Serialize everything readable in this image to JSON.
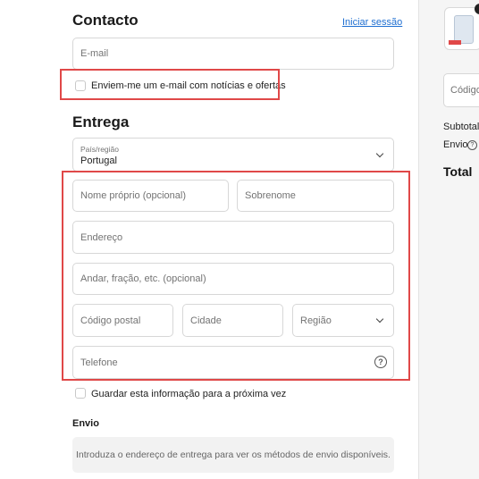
{
  "contact": {
    "title": "Contacto",
    "login_link": "Iniciar sessão",
    "email_placeholder": "E-mail",
    "newsletter_label": "Enviem-me um e-mail com notícias e ofertas"
  },
  "delivery": {
    "title": "Entrega",
    "country_label": "País/região",
    "country_value": "Portugal",
    "first_name_placeholder": "Nome próprio (opcional)",
    "last_name_placeholder": "Sobrenome",
    "address_placeholder": "Endereço",
    "apartment_placeholder": "Andar, fração, etc. (opcional)",
    "postal_code_placeholder": "Código postal",
    "city_placeholder": "Cidade",
    "region_placeholder": "Região",
    "phone_placeholder": "Telefone",
    "save_info_label": "Guardar esta informação para a próxima vez"
  },
  "shipping": {
    "title": "Envio",
    "info_text": "Introduza o endereço de entrega para ver os métodos de envio disponíveis."
  },
  "summary": {
    "discount_placeholder": "Código",
    "subtotal_label": "Subtotal",
    "shipping_label": "Envio",
    "total_label": "Total"
  }
}
